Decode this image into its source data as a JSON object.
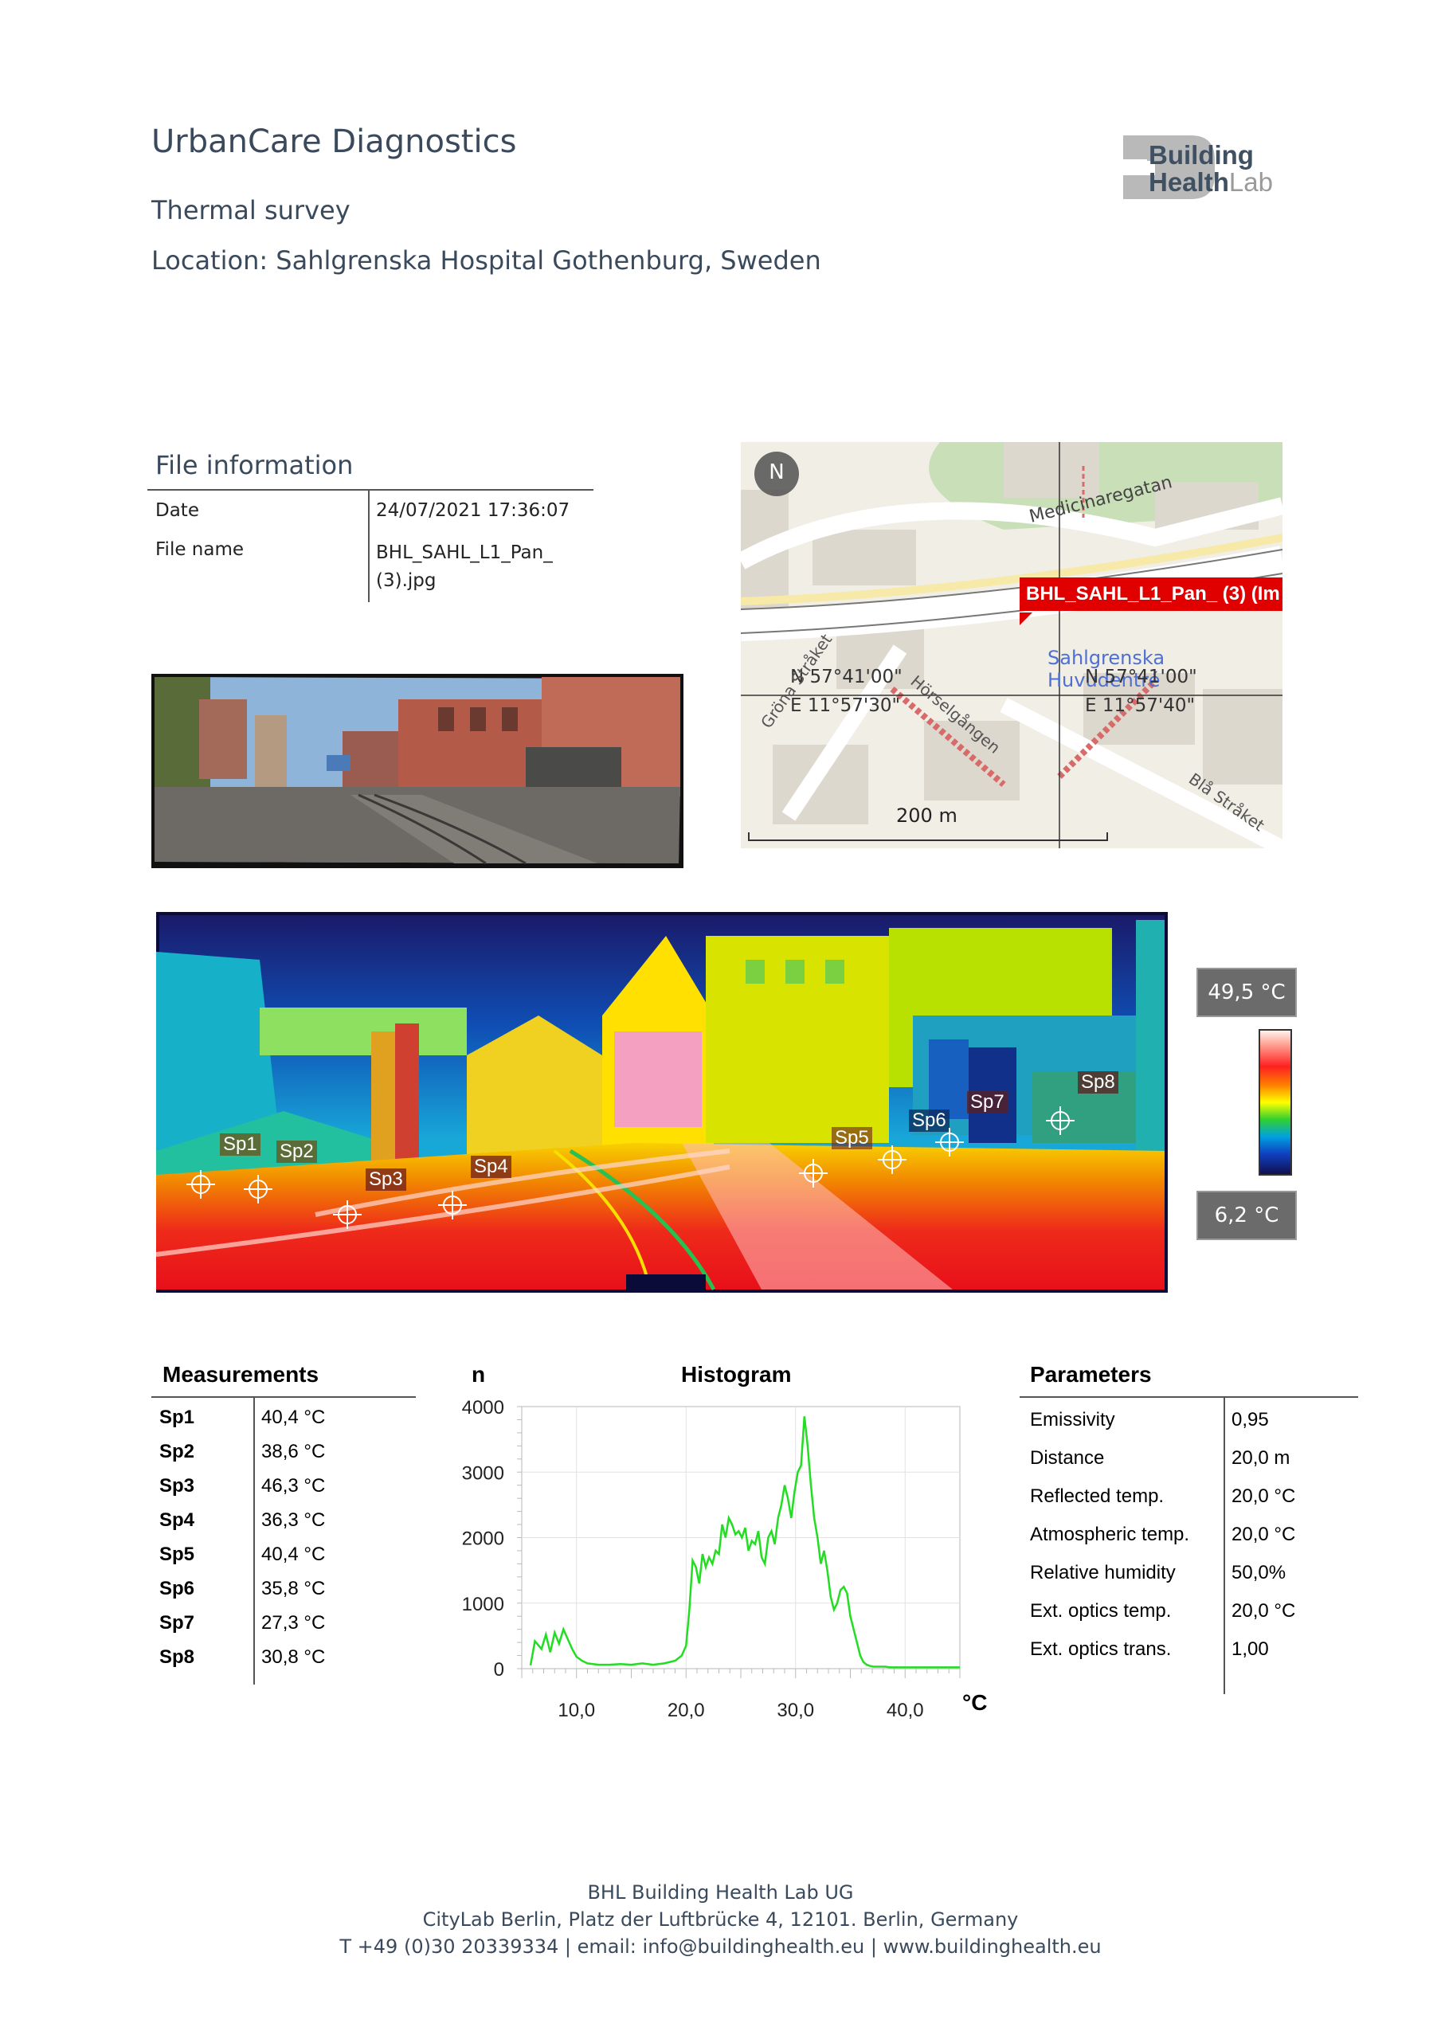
{
  "header": {
    "title": "UrbanCare Diagnostics",
    "subtitle": "Thermal survey",
    "location": "Location: Sahlgrenska Hospital Gothenburg, Sweden",
    "logo_line1": "Building",
    "logo_line2a": "Health",
    "logo_line2b": "Lab"
  },
  "file_info": {
    "title": "File information",
    "rows": [
      {
        "label": "Date",
        "value": "24/07/2021 17:36:07"
      },
      {
        "label": "File name",
        "value": "BHL_SAHL_L1_Pan_ (3).jpg"
      }
    ]
  },
  "map": {
    "north": "N",
    "street1": "Medicinaregatan",
    "marker_label": "BHL_SAHL_L1_Pan_ (3) (Im",
    "place1": "Sahlgrenska",
    "place2": "Huvudentré",
    "coord_n1": "N 57°41'00\"",
    "coord_e1": "E 11°57'30\"",
    "coord_n2": "N 57°41'00\"",
    "coord_e2": "E 11°57'40\"",
    "street2": "Gröna Stråket",
    "street3": "Hörselgången",
    "street4": "Blå Stråket",
    "scale": "200 m"
  },
  "thermal": {
    "max": "49,5 °C",
    "min": "6,2 °C",
    "spots": [
      "Sp1",
      "Sp2",
      "Sp3",
      "Sp4",
      "Sp5",
      "Sp6",
      "Sp7",
      "Sp8"
    ]
  },
  "measurements": {
    "title": "Measurements",
    "rows": [
      {
        "label": "Sp1",
        "value": "40,4 °C"
      },
      {
        "label": "Sp2",
        "value": "38,6 °C"
      },
      {
        "label": "Sp3",
        "value": "46,3 °C"
      },
      {
        "label": "Sp4",
        "value": "36,3 °C"
      },
      {
        "label": "Sp5",
        "value": "40,4 °C"
      },
      {
        "label": "Sp6",
        "value": "35,8 °C"
      },
      {
        "label": "Sp7",
        "value": "27,3 °C"
      },
      {
        "label": "Sp8",
        "value": "30,8 °C"
      }
    ]
  },
  "chart_data": {
    "type": "line",
    "title": "Histogram",
    "ylabel": "n",
    "xlabel": "°C",
    "xlim": [
      5,
      45
    ],
    "ylim": [
      0,
      4000
    ],
    "x_ticks": [
      "10,0",
      "20,0",
      "30,0",
      "40,0"
    ],
    "x_tick_values": [
      10,
      20,
      30,
      40
    ],
    "y_ticks": [
      "0",
      "1000",
      "2000",
      "3000",
      "4000"
    ],
    "y_tick_values": [
      0,
      1000,
      2000,
      3000,
      4000
    ],
    "color": "#22dd22",
    "x": [
      5.8,
      6.2,
      6.8,
      7.2,
      7.6,
      8.0,
      8.4,
      8.8,
      9.2,
      9.6,
      10.0,
      10.5,
      11,
      12,
      13,
      14,
      15,
      16,
      17,
      18,
      19,
      19.6,
      20,
      20.3,
      20.6,
      20.9,
      21.2,
      21.5,
      21.8,
      22.1,
      22.4,
      22.7,
      23,
      23.3,
      23.6,
      23.9,
      24.2,
      24.5,
      24.8,
      25.1,
      25.4,
      25.7,
      26,
      26.3,
      26.6,
      26.9,
      27.2,
      27.5,
      27.8,
      28.1,
      28.4,
      28.7,
      29,
      29.3,
      29.6,
      29.9,
      30.2,
      30.5,
      30.8,
      31.1,
      31.4,
      31.7,
      32,
      32.3,
      32.6,
      32.9,
      33.2,
      33.5,
      33.8,
      34.1,
      34.4,
      34.7,
      35,
      35.3,
      35.6,
      35.9,
      36.2,
      36.5,
      36.8,
      37.1,
      37.4,
      37.8,
      38.2,
      38.6,
      39,
      40,
      41,
      42,
      43,
      44,
      45
    ],
    "y": [
      50,
      420,
      300,
      520,
      250,
      550,
      380,
      600,
      450,
      300,
      180,
      120,
      80,
      60,
      60,
      70,
      60,
      80,
      60,
      80,
      120,
      200,
      350,
      900,
      1650,
      1550,
      1300,
      1750,
      1550,
      1700,
      1600,
      1800,
      1750,
      2200,
      2000,
      2300,
      2200,
      2050,
      2100,
      2000,
      2150,
      1800,
      1950,
      1900,
      2100,
      1700,
      1600,
      2000,
      2100,
      1900,
      2300,
      2500,
      2800,
      2600,
      2300,
      2700,
      3000,
      3100,
      3850,
      3400,
      2800,
      2300,
      2000,
      1600,
      1800,
      1500,
      1100,
      900,
      1000,
      1200,
      1250,
      1150,
      800,
      600,
      400,
      200,
      100,
      60,
      40,
      30,
      30,
      30,
      30,
      20,
      20,
      20,
      20,
      20,
      20,
      20,
      20
    ]
  },
  "parameters": {
    "title": "Parameters",
    "rows": [
      {
        "label": "Emissivity",
        "value": "0,95"
      },
      {
        "label": "Distance",
        "value": "20,0 m"
      },
      {
        "label": "Reflected temp.",
        "value": "20,0 °C"
      },
      {
        "label": "Atmospheric temp.",
        "value": "20,0 °C"
      },
      {
        "label": "Relative humidity",
        "value": "50,0%"
      },
      {
        "label": "Ext. optics temp.",
        "value": "20,0 °C"
      },
      {
        "label": "Ext. optics trans.",
        "value": "1,00"
      }
    ]
  },
  "footer": {
    "line1": "BHL Building Health Lab UG",
    "line2": "CityLab Berlin, Platz der Luftbrücke 4, 12101. Berlin, Germany",
    "line3": "T +49 (0)30 20339334 | email: info@buildinghealth.eu | www.buildinghealth.eu"
  }
}
